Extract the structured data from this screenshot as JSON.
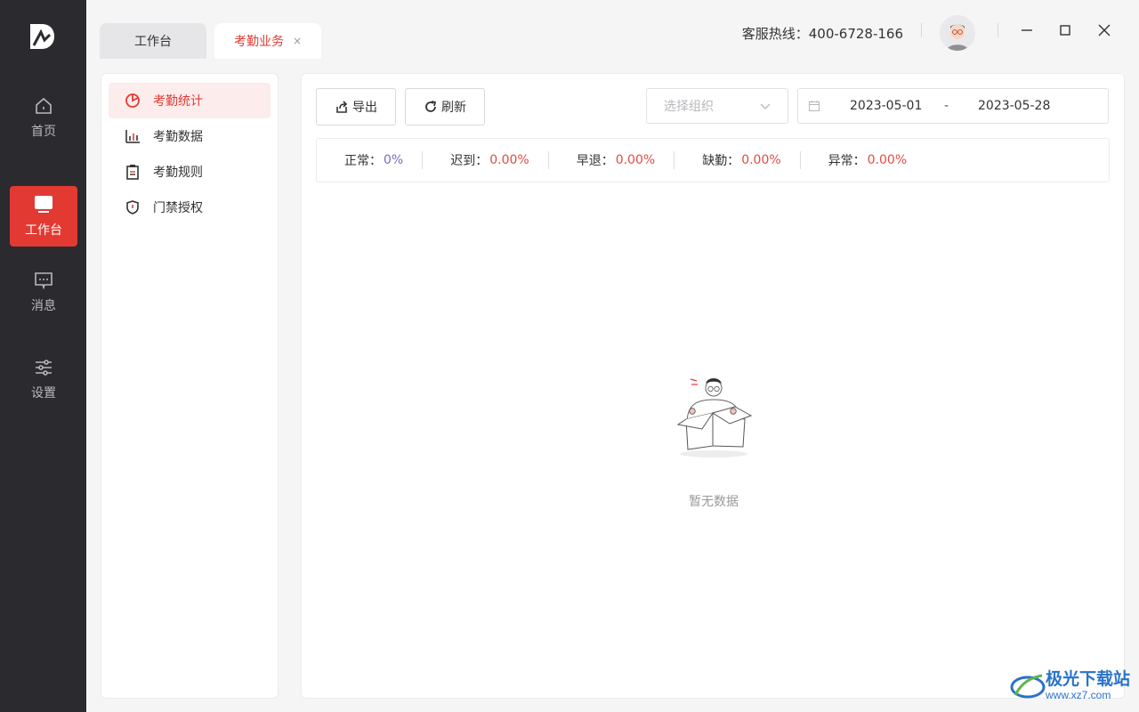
{
  "rail": {
    "items": [
      {
        "label": "首页",
        "icon": "home-icon"
      },
      {
        "label": "工作台",
        "icon": "monitor-icon",
        "active": true
      },
      {
        "label": "消息",
        "icon": "message-icon"
      },
      {
        "label": "设置",
        "icon": "sliders-icon"
      }
    ]
  },
  "tabs": [
    {
      "label": "工作台"
    },
    {
      "label": "考勤业务",
      "close": "×",
      "active": true
    }
  ],
  "header": {
    "hotline": "客服热线：400-6728-166"
  },
  "subnav": {
    "items": [
      {
        "label": "考勤统计",
        "icon": "pie-chart-icon",
        "active": true
      },
      {
        "label": "考勤数据",
        "icon": "bar-chart-icon"
      },
      {
        "label": "考勤规则",
        "icon": "clipboard-icon"
      },
      {
        "label": "门禁授权",
        "icon": "shield-icon"
      }
    ]
  },
  "toolbar": {
    "export_label": "导出",
    "refresh_label": "刷新",
    "org_placeholder": "选择组织",
    "date_start": "2023-05-01",
    "date_sep": "-",
    "date_end": "2023-05-28"
  },
  "stats": [
    {
      "label": "正常：",
      "value": "0%"
    },
    {
      "label": "迟到：",
      "value": "0.00%"
    },
    {
      "label": "早退：",
      "value": "0.00%"
    },
    {
      "label": "缺勤：",
      "value": "0.00%"
    },
    {
      "label": "异常：",
      "value": "0.00%"
    }
  ],
  "empty_text": "暂无数据",
  "watermark": {
    "line1": "极光下载站",
    "line2": "www.xz7.com"
  },
  "colors": {
    "accent": "#e23a32",
    "rail_bg": "#2b2a2f",
    "normal_value": "#7a6bc9",
    "bad_value": "#e14b43"
  }
}
